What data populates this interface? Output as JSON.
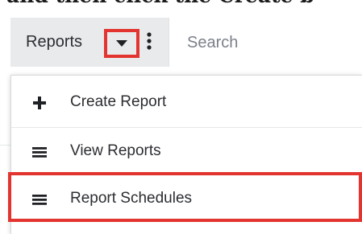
{
  "instruction_text": "and then click the Create b",
  "header": {
    "module_tab_label": "Reports",
    "search_placeholder": "Search"
  },
  "icons": {
    "caret": "chevron-down-icon",
    "more": "kebab-icon",
    "create": "plus-icon",
    "list": "list-icon"
  },
  "menu": {
    "items": [
      {
        "label": "Create Report",
        "icon": "plus-icon"
      },
      {
        "label": "View Reports",
        "icon": "list-icon"
      },
      {
        "label": "Report Schedules",
        "icon": "list-icon"
      }
    ]
  },
  "colors": {
    "highlight": "#e3342f",
    "tab_background": "#e8eaec"
  }
}
